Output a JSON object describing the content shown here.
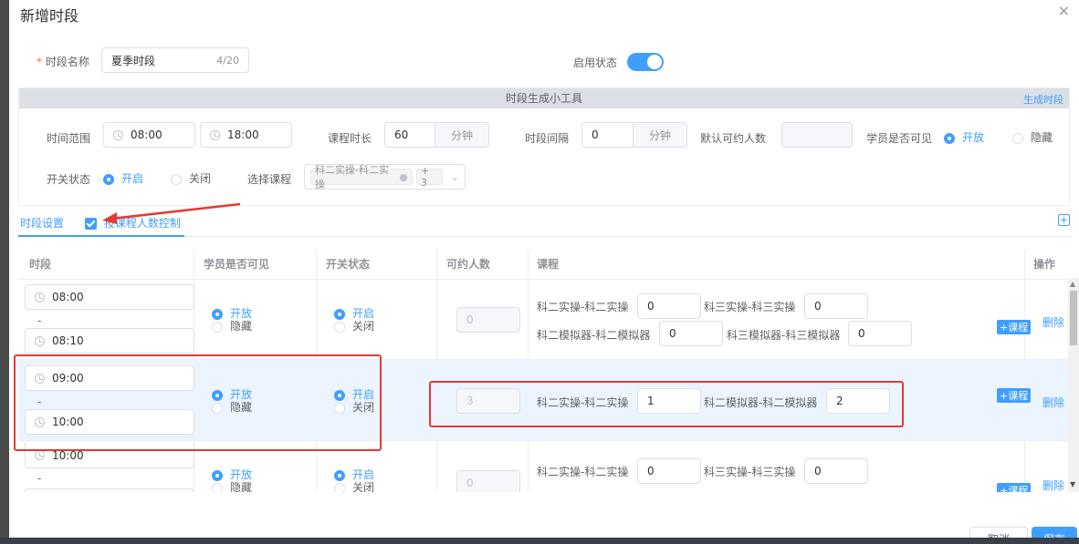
{
  "dialog": {
    "title": "新增时段",
    "close": "×"
  },
  "name_field": {
    "required_mark": "*",
    "label": "时段名称",
    "value": "夏季时段",
    "counter": "4/20"
  },
  "enable": {
    "label": "启用状态",
    "on": true
  },
  "tool": {
    "header": "时段生成小工具",
    "generate_link": "生成时段",
    "time_range_label": "时间范围",
    "time_start": "08:00",
    "time_end": "18:00",
    "course_duration_label": "课程时长",
    "course_duration_value": "60",
    "course_duration_unit": "分钟",
    "interval_label": "时段间隔",
    "interval_value": "0",
    "interval_unit": "分钟",
    "default_capacity_label": "默认可约人数",
    "visible_label": "学员是否可见",
    "visible_open": "开放",
    "visible_hidden": "隐藏",
    "switch_label": "开关状态",
    "switch_on": "开启",
    "switch_off": "关闭",
    "select_course_label": "选择课程",
    "select_tag": "科二实操-科二实操",
    "select_more": "+ 3"
  },
  "tabs": {
    "active": "时段设置",
    "checkbox_label": "按课程人数控制",
    "add": "+"
  },
  "table": {
    "headers": [
      "时段",
      "学员是否可见",
      "开关状态",
      "可约人数",
      "课程",
      "操作"
    ],
    "rows": [
      {
        "start": "08:00",
        "sep": "-",
        "end": "08:10",
        "open": "开放",
        "hidden": "隐藏",
        "on": "开启",
        "off": "关闭",
        "capacity": "0",
        "courses": [
          {
            "name": "科二实操-科二实操",
            "value": "0"
          },
          {
            "name": "科三实操-科三实操",
            "value": "0"
          },
          {
            "name": "科二模拟器-科二模拟器",
            "value": "0"
          },
          {
            "name": "科三模拟器-科三模拟器",
            "value": "0"
          }
        ],
        "add_course": "+课程",
        "delete": "删除"
      },
      {
        "start": "09:00",
        "sep": "-",
        "end": "10:00",
        "open": "开放",
        "hidden": "隐藏",
        "on": "开启",
        "off": "关闭",
        "capacity": "3",
        "courses": [
          {
            "name": "科二实操-科二实操",
            "value": "1"
          },
          {
            "name": "科二模拟器-科二模拟器",
            "value": "2"
          }
        ],
        "add_course": "+课程",
        "delete": "删除"
      },
      {
        "start": "10:00",
        "sep": "-",
        "end": "",
        "open": "开放",
        "hidden": "隐藏",
        "on": "开启",
        "off": "关闭",
        "capacity": "0",
        "courses": [
          {
            "name": "科二实操-科二实操",
            "value": "0"
          },
          {
            "name": "科三实操-科三实操",
            "value": "0"
          }
        ],
        "add_course": "+课程",
        "delete": "删除"
      }
    ]
  },
  "footer": {
    "cancel": "取消",
    "save": "保存"
  },
  "colors": {
    "primary": "#409eff",
    "annotation": "#e53935"
  }
}
